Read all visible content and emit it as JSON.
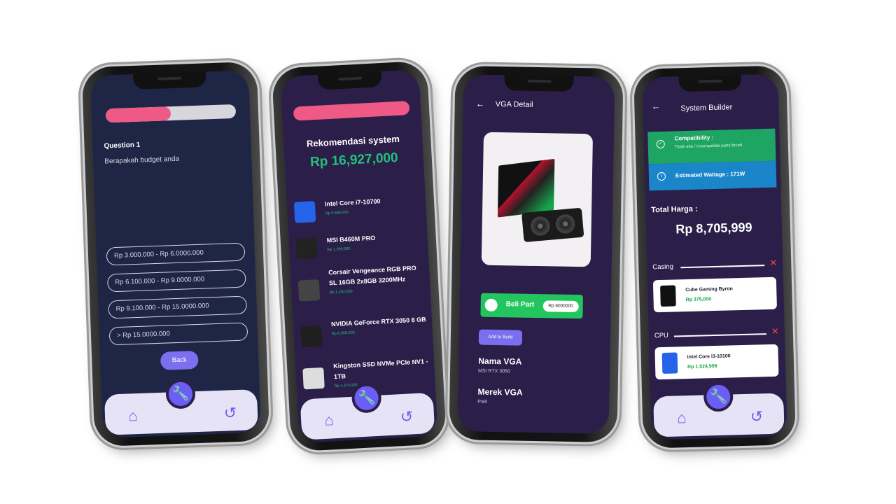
{
  "screen1": {
    "progress": 0.5,
    "question_title": "Question 1",
    "question_text": "Berapakah budget anda",
    "options": [
      "Rp 3.000.000 - Rp 6.0000.000",
      "Rp 6.100.000 - Rp 9.0000.000",
      "Rp 9.100.000 - Rp 15.0000.000",
      "> Rp 15.0000.000"
    ],
    "back_label": "Back"
  },
  "screen2": {
    "title": "Rekomendasi system",
    "total_price": "Rp 16,927,000",
    "items": [
      {
        "name": "Intel Core i7-10700",
        "price": "Rp 5,590,000",
        "thumb_color": "#2563eb"
      },
      {
        "name": "MSI B460M PRO",
        "price": "Rp 1,399,000",
        "thumb_color": "#222222"
      },
      {
        "name": "Corsair Vengeance RGB PRO SL 16GB 2x8GB 3200MHz",
        "price": "Rp 1,282,000",
        "thumb_color": "#444444"
      },
      {
        "name": "NVIDIA GeForce RTX 3050 8 GB",
        "price": "Rp 6,000,000",
        "thumb_color": "#1f1f1f"
      },
      {
        "name": "Kingston SSD NVMe PCIe NV1 - 1TB",
        "price": "Rp 1,370,000",
        "thumb_color": "#dddddd"
      }
    ]
  },
  "screen3": {
    "back_icon": "arrow-left-icon",
    "title": "VGA Detail",
    "beli_label": "Beli Part",
    "beli_price": "Rp 6000000",
    "add_label": "Add to Build",
    "nama_label": "Nama VGA",
    "nama_value": "MSI RTX 3050",
    "merek_label": "Merek VGA",
    "merek_value": "Palit"
  },
  "screen4": {
    "title": "System Builder",
    "compat_title": "Compatibility :",
    "compat_sub": "Tidak ada / incompatible parts found",
    "watt_title": "Estimated Wattage : 171W",
    "total_label": "Total Harga :",
    "total_value": "Rp 8,705,999",
    "sections": [
      {
        "label": "Casing",
        "part_name": "Cube Gaming Byron",
        "part_price": "Rp 375,000",
        "thumb_color": "#111111"
      },
      {
        "label": "CPU",
        "part_name": "Intel Core i3-10100",
        "part_price": "Rp 1,524,999",
        "thumb_color": "#2563eb"
      }
    ]
  },
  "colors": {
    "accent": "#6b5ef5",
    "pink": "#ee5a85",
    "green": "#22c17a",
    "navy_bg": "#1f2545",
    "purple_bg": "#2b1f4a"
  }
}
